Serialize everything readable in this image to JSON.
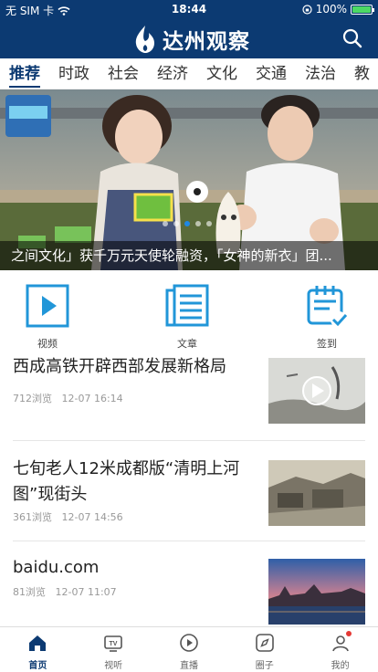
{
  "statusbar": {
    "carrier": "无 SIM 卡",
    "time": "18:44",
    "battery": "100%",
    "battery_level": 1.0
  },
  "appbar": {
    "title": "达州观察",
    "search_icon": "search-icon"
  },
  "tabs": [
    "推荐",
    "时政",
    "社会",
    "经济",
    "文化",
    "交通",
    "法治",
    "教"
  ],
  "active_tab": "推荐",
  "banner": {
    "caption": "之间文化」获千万元天使轮融资，「女神的新衣」团...",
    "slide_count": 5,
    "active_slide": 2
  },
  "quick": [
    {
      "label": "视频",
      "icon": "play-square-icon"
    },
    {
      "label": "文章",
      "icon": "article-icon"
    },
    {
      "label": "签到",
      "icon": "calendar-check-icon"
    }
  ],
  "news": [
    {
      "title": "西成高铁开辟西部发展新格局",
      "views": "712浏览",
      "date": "12-07 16:14",
      "has_video": true
    },
    {
      "title": "七旬老人12米成都版“清明上河图”现街头",
      "views": "361浏览",
      "date": "12-07 14:56",
      "has_video": false
    },
    {
      "title": "baidu.com",
      "views": "81浏览",
      "date": "12-07 11:07",
      "has_video": false
    }
  ],
  "bottomnav": [
    {
      "label": "首页",
      "icon": "home-icon",
      "active": true
    },
    {
      "label": "视听",
      "icon": "tv-icon",
      "active": false
    },
    {
      "label": "直播",
      "icon": "live-play-icon",
      "active": false
    },
    {
      "label": "圈子",
      "icon": "compass-icon",
      "active": false
    },
    {
      "label": "我的",
      "icon": "user-icon",
      "active": false,
      "badge": true
    }
  ],
  "colors": {
    "brand": "#0c3a72",
    "accent": "#1e88e5",
    "badge": "#e53935"
  }
}
